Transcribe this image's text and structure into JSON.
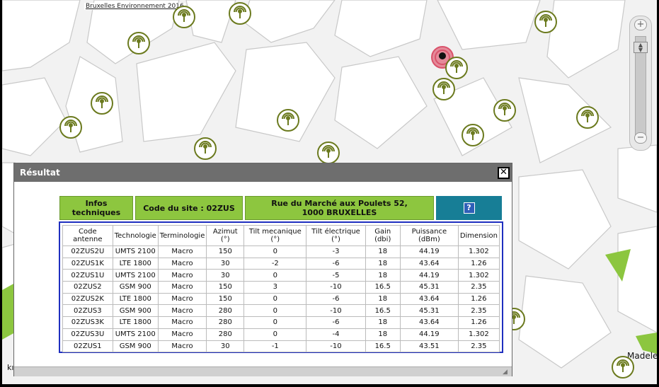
{
  "map": {
    "attribution": "Bruxelles Environnement 2016",
    "label_right": "Madele",
    "label_left": "kı"
  },
  "zoom": {
    "in_label": "+",
    "out_label": "−"
  },
  "dialog": {
    "title": "Résultat",
    "close_label": "✕",
    "info": {
      "tech_label": "Infos techniques",
      "site_code": "Code du site : 02ZUS",
      "address": "Rue du Marché aux Poulets 52, 1000 BRUXELLES",
      "help_label": "?"
    },
    "table": {
      "headers": [
        "Code antenne",
        "Technologie",
        "Terminologie",
        "Azimut (°)",
        "Tilt mecanique (°)",
        "Tilt électrique (°)",
        "Gain (dbi)",
        "Puissance (dBm)",
        "Dimension"
      ],
      "rows": [
        [
          "02ZUS2U",
          "UMTS 2100",
          "Macro",
          "150",
          "0",
          "-3",
          "18",
          "44.19",
          "1.302"
        ],
        [
          "02ZUS1K",
          "LTE 1800",
          "Macro",
          "30",
          "-2",
          "-6",
          "18",
          "43.64",
          "1.26"
        ],
        [
          "02ZUS1U",
          "UMTS 2100",
          "Macro",
          "30",
          "0",
          "-5",
          "18",
          "44.19",
          "1.302"
        ],
        [
          "02ZUS2",
          "GSM 900",
          "Macro",
          "150",
          "3",
          "-10",
          "16.5",
          "45.31",
          "2.35"
        ],
        [
          "02ZUS2K",
          "LTE 1800",
          "Macro",
          "150",
          "0",
          "-6",
          "18",
          "43.64",
          "1.26"
        ],
        [
          "02ZUS3",
          "GSM 900",
          "Macro",
          "280",
          "0",
          "-10",
          "16.5",
          "45.31",
          "2.35"
        ],
        [
          "02ZUS3K",
          "LTE 1800",
          "Macro",
          "280",
          "0",
          "-6",
          "18",
          "43.64",
          "1.26"
        ],
        [
          "02ZUS3U",
          "UMTS 2100",
          "Macro",
          "280",
          "0",
          "-4",
          "18",
          "44.19",
          "1.302"
        ],
        [
          "02ZUS1",
          "GSM 900",
          "Macro",
          "30",
          "-1",
          "-10",
          "16.5",
          "43.51",
          "2.35"
        ]
      ]
    }
  },
  "colors": {
    "antenna": "#6b7a1e",
    "selected_marker": "#d9536b",
    "info_green": "#8dc63f",
    "help_teal": "#177e96",
    "table_border": "#1f2fbf",
    "park_green": "#8cc63f"
  },
  "icons": {
    "antenna": "antenna-site-icon",
    "selected": "selected-site-marker-icon",
    "close": "close-icon",
    "help": "help-icon"
  }
}
